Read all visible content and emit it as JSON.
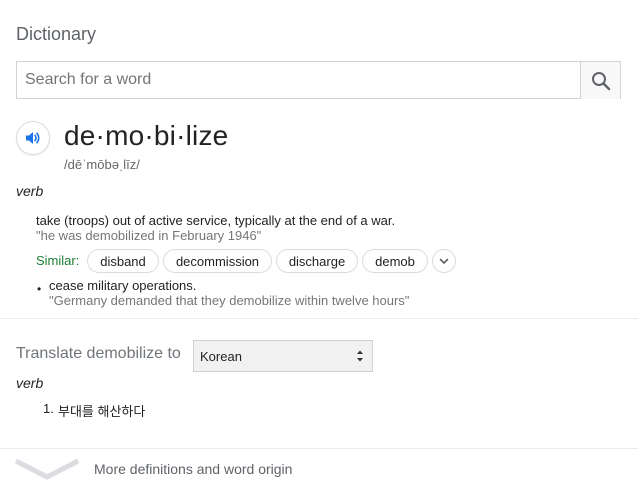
{
  "header": {
    "title": "Dictionary"
  },
  "search": {
    "placeholder": "Search for a word",
    "value": "",
    "icon": "search-icon"
  },
  "entry": {
    "headword": "de·mo·bi·lize",
    "phonetic": "/dēˈmōbəˌlīz/",
    "speaker_icon": "speaker-icon",
    "pos": "verb",
    "senses": [
      {
        "definition": "take (troops) out of active service, typically at the end of a war.",
        "example": "\"he was demobilized in February 1946\""
      },
      {
        "definition": "cease military operations.",
        "example": "\"Germany demanded that they demobilize within twelve hours\""
      }
    ],
    "similar_label": "Similar:",
    "similar": [
      "disband",
      "decommission",
      "discharge",
      "demob"
    ]
  },
  "translate": {
    "label": "Translate demobilize to",
    "selected_language": "Korean",
    "pos": "verb",
    "items": [
      {
        "num": "1.",
        "text": "부대를 해산하다"
      }
    ]
  },
  "footer": {
    "more_label": "More definitions and word origin"
  },
  "colors": {
    "accent_blue": "#1a73e8",
    "similar_green": "#1e7e34",
    "example_gray": "#767676"
  }
}
